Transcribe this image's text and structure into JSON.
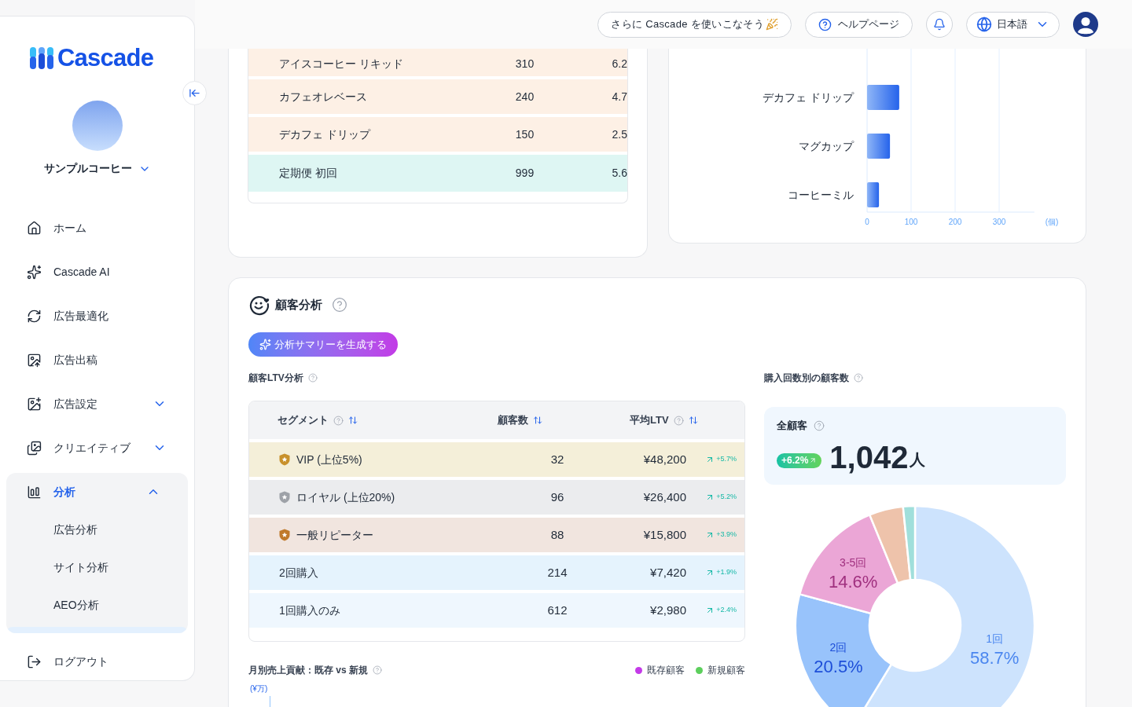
{
  "topbar": {
    "promo": "さらに Cascade を使いこなそう",
    "help": "ヘルプページ",
    "language": "日本語"
  },
  "sidebar": {
    "logo": "Cascade",
    "store": "サンプルコーヒー",
    "nav": [
      {
        "label": "ホーム",
        "selected": false
      },
      {
        "label": "Cascade AI",
        "selected": false
      },
      {
        "label": "広告最適化",
        "selected": false
      },
      {
        "label": "広告出稿",
        "selected": false
      },
      {
        "label": "広告設定",
        "selected": false,
        "expanded": false
      },
      {
        "label": "クリエイティブ",
        "selected": false,
        "expanded": false
      },
      {
        "label": "分析",
        "selected": true,
        "expanded": true,
        "children": [
          {
            "label": "広告分析",
            "selected": false
          },
          {
            "label": "サイト分析",
            "selected": false
          },
          {
            "label": "AEO分析",
            "selected": false
          }
        ]
      }
    ],
    "logout": "ログアウト"
  },
  "product_table": {
    "rows": [
      {
        "name": "アイスコーヒー リキッド",
        "column_2": "310",
        "column_3": "6.2",
        "color": "#fdf0e5"
      },
      {
        "name": "カフェオレベース",
        "column_2": "240",
        "column_3": "4.7",
        "color": "#fdf0e5"
      },
      {
        "name": "デカフェ ドリップ",
        "column_2": "150",
        "column_3": "2.5",
        "color": "#fdf0e5"
      },
      {
        "name": "定期便 初回",
        "column_2": "999",
        "column_3": "5.6",
        "color": "#def6f3"
      }
    ]
  },
  "product_chart": {
    "chart_data": {
      "type": "bar",
      "orientation": "horizontal",
      "categories": [
        "デカフェ ドリップ",
        "マグカップ",
        "コーヒーミル"
      ],
      "values": [
        73,
        52,
        27
      ],
      "xlim": [
        0,
        380
      ],
      "grid": true,
      "xticks": [
        0,
        100,
        200,
        300
      ],
      "xlabel": "(個)"
    }
  },
  "customer_analysis": {
    "title": "顧客分析",
    "summary_button": "分析サマリーを生成する",
    "ltv": {
      "title": "顧客LTV分析",
      "columns": [
        {
          "label": "セグメント",
          "help": true
        },
        {
          "label": "顧客数",
          "help": false
        },
        {
          "label": "平均LTV",
          "help": true
        }
      ],
      "rows": [
        {
          "segment": "VIP (上位5%)",
          "customers": "32",
          "avg_ltv": "¥48,200",
          "change": "+5.7%",
          "color": "#f4efd9",
          "badge": {
            "color": "#c8912c"
          }
        },
        {
          "segment": "ロイヤル (上位20%)",
          "customers": "96",
          "avg_ltv": "¥26,400",
          "change": "+5.2%",
          "color": "#ebecee",
          "badge": {
            "color": "#9ea2a8"
          }
        },
        {
          "segment": "一般リピーター",
          "customers": "88",
          "avg_ltv": "¥15,800",
          "change": "+3.9%",
          "color": "#f1e5df",
          "badge": {
            "color": "#c07a2c"
          }
        },
        {
          "segment": "2回購入",
          "customers": "214",
          "avg_ltv": "¥7,420",
          "change": "+1.9%",
          "color": "#e5f3fd"
        },
        {
          "segment": "1回購入のみ",
          "customers": "612",
          "avg_ltv": "¥2,980",
          "change": "+2.4%",
          "color": "#eff7fe"
        }
      ]
    },
    "monthly": {
      "title": "月別売上貢献：既存 vs 新規",
      "legend": [
        {
          "label": "既存顧客",
          "color": "#c43ae8"
        },
        {
          "label": "新規顧客",
          "color": "#5ccf5c"
        }
      ],
      "unit": "(¥万)"
    },
    "purchase_count": {
      "title": "購入回数別の顧客数",
      "total_label": "全顧客",
      "change": "+6.2%",
      "total": "1,042",
      "unit": "人",
      "chart_data": {
        "type": "donut",
        "categories": [
          "1回",
          "2回",
          "3-5回",
          null,
          null
        ],
        "values": [
          58.7,
          20.5,
          14.6,
          4.6,
          1.6
        ],
        "value_labels": [
          "58.7%",
          "20.5%",
          "14.6%",
          null,
          null
        ],
        "colors": [
          "#cde3fd",
          "#98c3fb",
          "#eba6d6",
          "#eec3ab",
          "#a0dfdb"
        ]
      }
    }
  }
}
